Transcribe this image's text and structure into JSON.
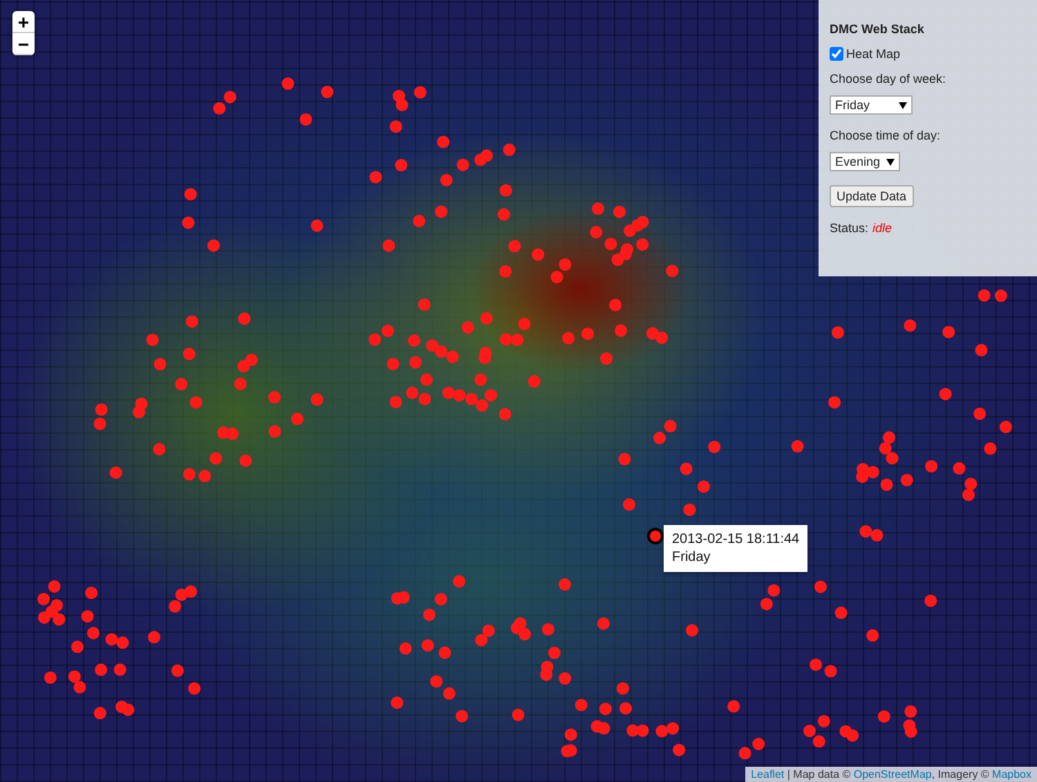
{
  "zoom_controls": [
    {
      "label": "+"
    },
    {
      "label": "−"
    }
  ],
  "panel": {
    "title": "DMC Web Stack",
    "heatmap": {
      "label": "Heat Map",
      "checked": true
    },
    "day_label": "Choose day of week:",
    "day_value": "Friday",
    "time_label": "Choose time of day:",
    "time_value": "Evening",
    "button": "Update Data",
    "status_label": "Status:",
    "status_value": "idle"
  },
  "popup": {
    "lines": [
      "2013-02-15 18:11:44",
      "Friday"
    ]
  },
  "attribution": [
    {
      "kind": "link",
      "text": "Leaflet"
    },
    {
      "kind": "text",
      "text": " | Map data © "
    },
    {
      "kind": "link",
      "text": "OpenStreetMap"
    },
    {
      "kind": "text",
      "text": ", Imagery © "
    },
    {
      "kind": "link",
      "text": "Mapbox"
    }
  ]
}
